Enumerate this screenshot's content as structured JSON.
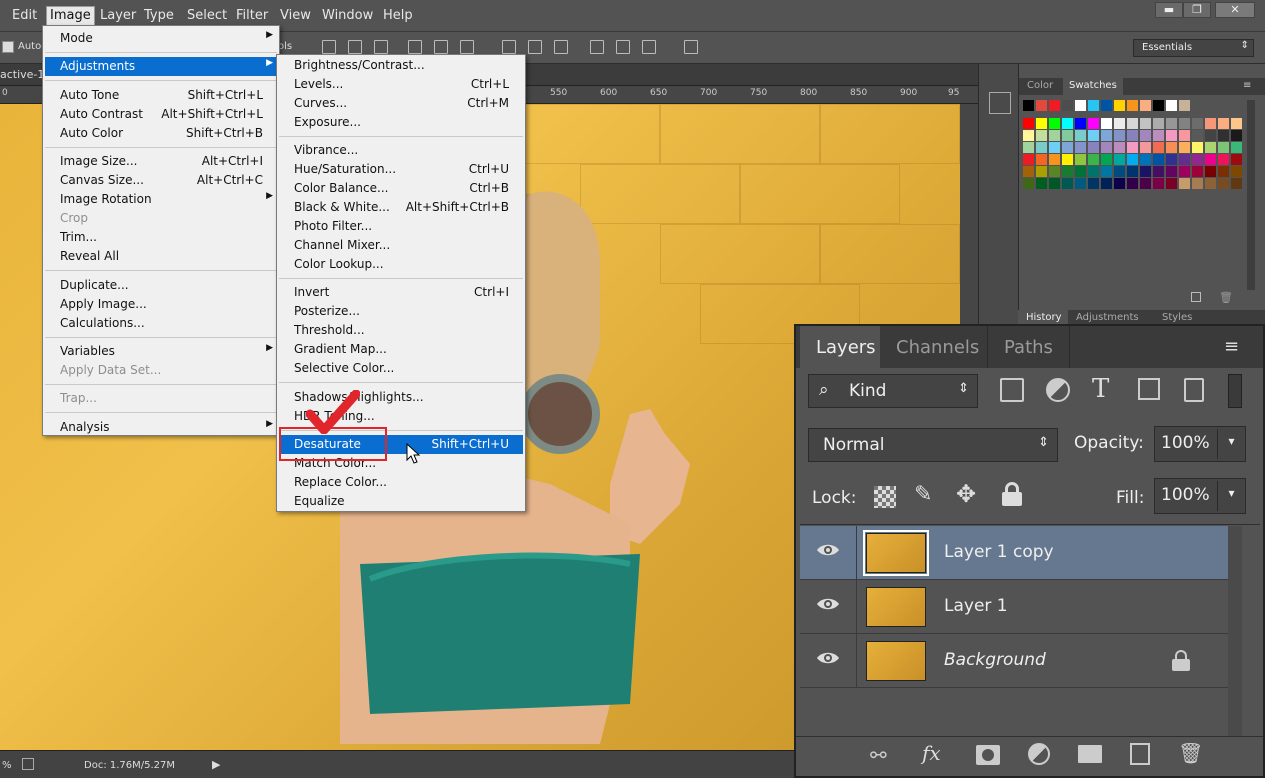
{
  "menubar": {
    "items": [
      "Edit",
      "Image",
      "Layer",
      "Type",
      "Select",
      "Filter",
      "View",
      "Window",
      "Help"
    ],
    "selected": "Image",
    "window_buttons": [
      "▬",
      "❐",
      "✕"
    ]
  },
  "options": {
    "auto_label": "Auto-",
    "frag": "ols",
    "workspace": "Essentials"
  },
  "doc": {
    "tab_title": "active-18",
    "ruler_ticks": [
      "0",
      "550",
      "600",
      "650",
      "700",
      "750",
      "800",
      "850",
      "900",
      "95"
    ],
    "status_zoom": "%",
    "status_doc": "Doc: 1.76M/5.27M"
  },
  "swatches": {
    "tabs": [
      "Color",
      "Swatches"
    ],
    "active": "Swatches"
  },
  "history_tabs": [
    "History",
    "Adjustments",
    "Styles"
  ],
  "image_menu": [
    {
      "label": "Mode",
      "arrow": true
    },
    {
      "sep": true
    },
    {
      "label": "Adjustments",
      "arrow": true,
      "highlight": true
    },
    {
      "sep": true
    },
    {
      "label": "Auto Tone",
      "shortcut": "Shift+Ctrl+L"
    },
    {
      "label": "Auto Contrast",
      "shortcut": "Alt+Shift+Ctrl+L"
    },
    {
      "label": "Auto Color",
      "shortcut": "Shift+Ctrl+B"
    },
    {
      "sep": true
    },
    {
      "label": "Image Size...",
      "shortcut": "Alt+Ctrl+I"
    },
    {
      "label": "Canvas Size...",
      "shortcut": "Alt+Ctrl+C"
    },
    {
      "label": "Image Rotation",
      "arrow": true
    },
    {
      "label": "Crop",
      "disabled": true
    },
    {
      "label": "Trim..."
    },
    {
      "label": "Reveal All"
    },
    {
      "sep": true
    },
    {
      "label": "Duplicate..."
    },
    {
      "label": "Apply Image..."
    },
    {
      "label": "Calculations..."
    },
    {
      "sep": true
    },
    {
      "label": "Variables",
      "arrow": true
    },
    {
      "label": "Apply Data Set...",
      "disabled": true
    },
    {
      "sep": true
    },
    {
      "label": "Trap...",
      "disabled": true
    },
    {
      "sep": true
    },
    {
      "label": "Analysis",
      "arrow": true
    }
  ],
  "adjust_menu": [
    {
      "label": "Brightness/Contrast..."
    },
    {
      "label": "Levels...",
      "shortcut": "Ctrl+L"
    },
    {
      "label": "Curves...",
      "shortcut": "Ctrl+M"
    },
    {
      "label": "Exposure..."
    },
    {
      "sep": true
    },
    {
      "label": "Vibrance..."
    },
    {
      "label": "Hue/Saturation...",
      "shortcut": "Ctrl+U"
    },
    {
      "label": "Color Balance...",
      "shortcut": "Ctrl+B"
    },
    {
      "label": "Black & White...",
      "shortcut": "Alt+Shift+Ctrl+B"
    },
    {
      "label": "Photo Filter..."
    },
    {
      "label": "Channel Mixer..."
    },
    {
      "label": "Color Lookup..."
    },
    {
      "sep": true
    },
    {
      "label": "Invert",
      "shortcut": "Ctrl+I"
    },
    {
      "label": "Posterize..."
    },
    {
      "label": "Threshold..."
    },
    {
      "label": "Gradient Map..."
    },
    {
      "label": "Selective Color..."
    },
    {
      "sep": true
    },
    {
      "label": "Shadows/Highlights..."
    },
    {
      "label": "HDR Toning..."
    },
    {
      "sep": true
    },
    {
      "label": "Desaturate",
      "shortcut": "Shift+Ctrl+U",
      "highlight": true
    },
    {
      "label": "Match Color..."
    },
    {
      "label": "Replace Color..."
    },
    {
      "label": "Equalize"
    }
  ],
  "layers_panel": {
    "tabs": [
      "Layers",
      "Channels",
      "Paths"
    ],
    "active_tab": "Layers",
    "filter_kind": "Kind",
    "blend_mode": "Normal",
    "opacity_label": "Opacity:",
    "opacity": "100%",
    "lock_label": "Lock:",
    "fill_label": "Fill:",
    "fill": "100%",
    "layers": [
      {
        "name": "Layer 1 copy",
        "selected": true,
        "locked": false,
        "italic": false
      },
      {
        "name": "Layer 1",
        "selected": false,
        "locked": false,
        "italic": false
      },
      {
        "name": "Background",
        "selected": false,
        "locked": true,
        "italic": true
      }
    ]
  },
  "colors": {
    "accent": "#0a6ed1",
    "annotation_red": "#e0262a",
    "panel_bg": "#535353",
    "selected_layer": "#66788f"
  }
}
